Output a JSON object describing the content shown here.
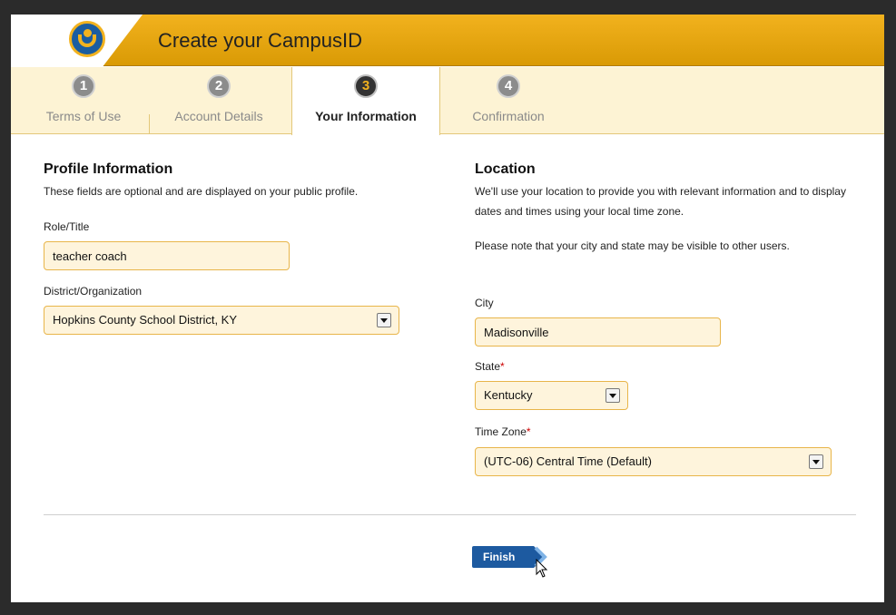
{
  "header": {
    "title": "Create your CampusID",
    "logo_icon": "campusid-logo"
  },
  "steps": [
    {
      "num": "1",
      "label": "Terms of Use"
    },
    {
      "num": "2",
      "label": "Account Details"
    },
    {
      "num": "3",
      "label": "Your Information"
    },
    {
      "num": "4",
      "label": "Confirmation"
    }
  ],
  "active_step": 3,
  "profile": {
    "title": "Profile Information",
    "description": "These fields are optional and are displayed on your public profile.",
    "role_label": "Role/Title",
    "role_value": "teacher coach",
    "district_label": "District/Organization",
    "district_value": "Hopkins County School District, KY"
  },
  "location": {
    "title": "Location",
    "description": "We'll use your location to provide you with relevant information and to display dates and times using your local time zone.",
    "note": "Please note that your city and state may be visible to other users.",
    "city_label": "City",
    "city_value": "Madisonville",
    "state_label": "State",
    "state_value": "Kentucky",
    "timezone_label": "Time Zone",
    "timezone_value": "(UTC-06) Central Time (Default)",
    "required_mark": "*"
  },
  "actions": {
    "finish_label": "Finish"
  },
  "colors": {
    "accent": "#f2b21e",
    "brand_blue": "#1d5aa0",
    "field_bg": "#fef4dc"
  }
}
